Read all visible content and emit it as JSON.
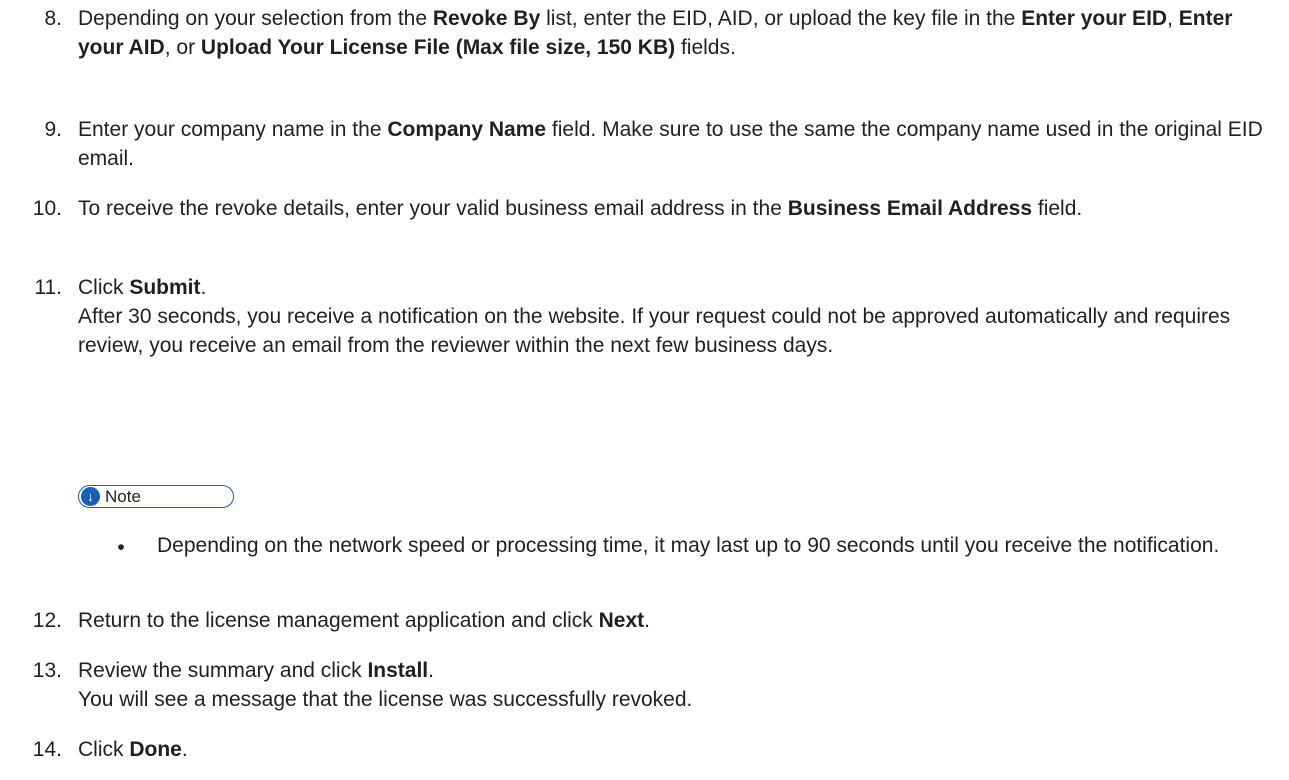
{
  "steps": [
    {
      "num": "8.",
      "parts": {
        "a": "Depending on your selection from the ",
        "b": "Revoke By",
        "c": " list, enter the EID, AID, or upload the key file in the ",
        "d": "Enter your EID",
        "e": ", ",
        "f": "Enter your AID",
        "g": ", or ",
        "h": "Upload Your License File (Max file size, 150 KB)",
        "i": " fields."
      }
    },
    {
      "num": "9.",
      "parts": {
        "a": "Enter your company name in the ",
        "b": "Company Name",
        "c": " field. Make sure to use the same the company name used in the original EID email."
      }
    },
    {
      "num": "10.",
      "parts": {
        "a": "To receive the revoke details, enter your valid business email address in the ",
        "b": "Business Email Address",
        "c": " field."
      }
    },
    {
      "num": "11.",
      "parts": {
        "a": "Click ",
        "b": "Submit",
        "c": ".",
        "detail": "After 30 seconds, you receive a notification on the website. If your request could not be approved automatically and requires review, you receive an email from the reviewer within the next few business days."
      }
    },
    {
      "num": "12.",
      "parts": {
        "a": "Return to the license management application and click ",
        "b": "Next",
        "c": "."
      }
    },
    {
      "num": "13.",
      "parts": {
        "a": "Review the summary and click ",
        "b": "Install",
        "c": ".",
        "detail": "You will see a message that the license was successfully revoked."
      }
    },
    {
      "num": "14.",
      "parts": {
        "a": "Click ",
        "b": "Done",
        "c": "."
      }
    }
  ],
  "note": {
    "label": "Note",
    "icon": "down-arrow-icon",
    "accent_color": "#1a5fb4",
    "bullet": "•",
    "items": [
      "Depending on the network speed or processing time, it may last up to 90 seconds until you receive the notification."
    ]
  }
}
